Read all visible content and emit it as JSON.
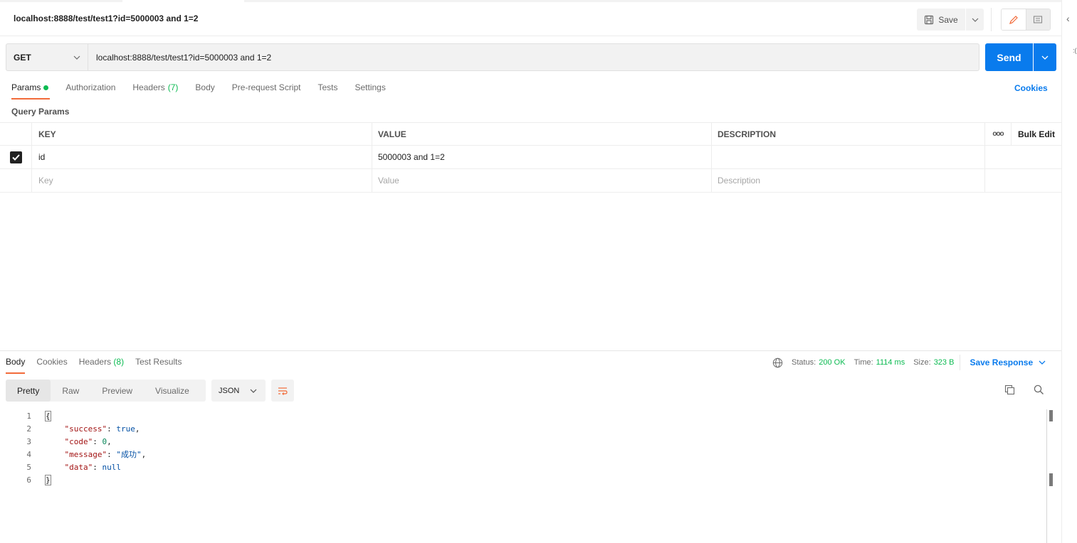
{
  "header": {
    "title": "localhost:8888/test/test1?id=5000003 and 1=2",
    "save_label": "Save"
  },
  "request": {
    "method": "GET",
    "url": "localhost:8888/test/test1?id=5000003 and 1=2",
    "send_label": "Send"
  },
  "tabs": {
    "params": "Params",
    "authorization": "Authorization",
    "headers": "Headers",
    "headers_count": "(7)",
    "body": "Body",
    "prerequest": "Pre-request Script",
    "tests": "Tests",
    "settings": "Settings",
    "cookies": "Cookies"
  },
  "query_params": {
    "label": "Query Params",
    "columns": {
      "key": "KEY",
      "value": "VALUE",
      "description": "DESCRIPTION",
      "more": "ooo",
      "bulk_edit": "Bulk Edit"
    },
    "rows": [
      {
        "key": "id",
        "value": "5000003 and 1=2",
        "description": "",
        "checked": true
      }
    ],
    "placeholders": {
      "key": "Key",
      "value": "Value",
      "description": "Description"
    }
  },
  "response": {
    "tabs": {
      "body": "Body",
      "cookies": "Cookies",
      "headers": "Headers",
      "headers_count": "(8)",
      "test_results": "Test Results"
    },
    "status_label": "Status:",
    "status": "200 OK",
    "time_label": "Time:",
    "time": "1114 ms",
    "size_label": "Size:",
    "size": "323 B",
    "save_response": "Save Response",
    "views": {
      "pretty": "Pretty",
      "raw": "Raw",
      "preview": "Preview",
      "visualize": "Visualize"
    },
    "format": "JSON",
    "lines": [
      "1",
      "2",
      "3",
      "4",
      "5",
      "6"
    ],
    "json": {
      "open": "{",
      "k_success": "\"success\"",
      "v_success": "true",
      "k_code": "\"code\"",
      "v_code": "0",
      "k_message": "\"message\"",
      "v_message": "\"成功\"",
      "k_data": "\"data\"",
      "v_data": "null",
      "close": "}"
    }
  },
  "colors": {
    "accent": "#097bed",
    "active_tab": "#f26b3a",
    "success": "#0cbb52"
  },
  "icons": [
    "save-icon",
    "chevron-down-icon",
    "pencil-icon",
    "comment-icon",
    "globe-icon",
    "wrap-lines-icon",
    "copy-icon",
    "search-icon",
    "checkbox-icon",
    "chevron-left-icon"
  ]
}
